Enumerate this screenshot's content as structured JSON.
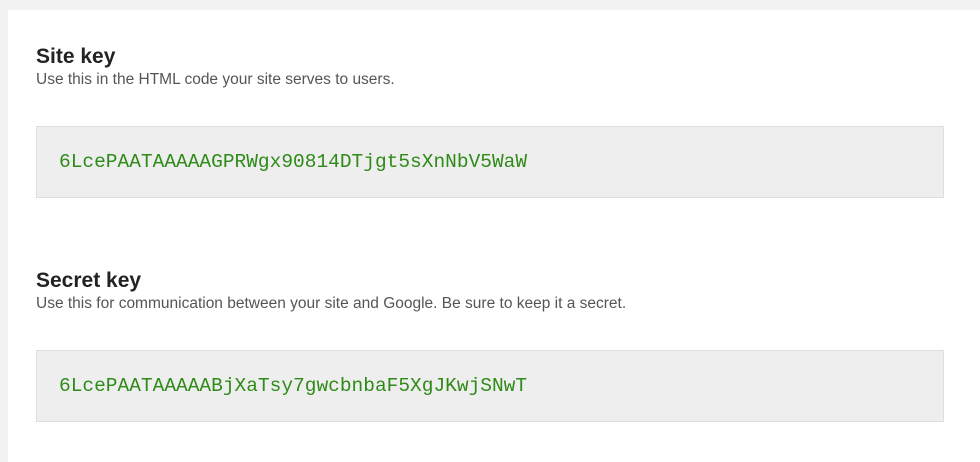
{
  "site_key": {
    "title": "Site key",
    "description": "Use this in the HTML code your site serves to users.",
    "value": "6LcePAATAAAAAGPRWgx90814DTjgt5sXnNbV5WaW"
  },
  "secret_key": {
    "title": "Secret key",
    "description": "Use this for communication between your site and Google. Be sure to keep it a secret.",
    "value": "6LcePAATAAAAABjXaTsy7gwcbnbaF5XgJKwjSNwT"
  },
  "colors": {
    "key_text": "#2e8b18",
    "key_box_bg": "#eeeeee",
    "title_text": "#222222",
    "description_text": "#555555"
  }
}
